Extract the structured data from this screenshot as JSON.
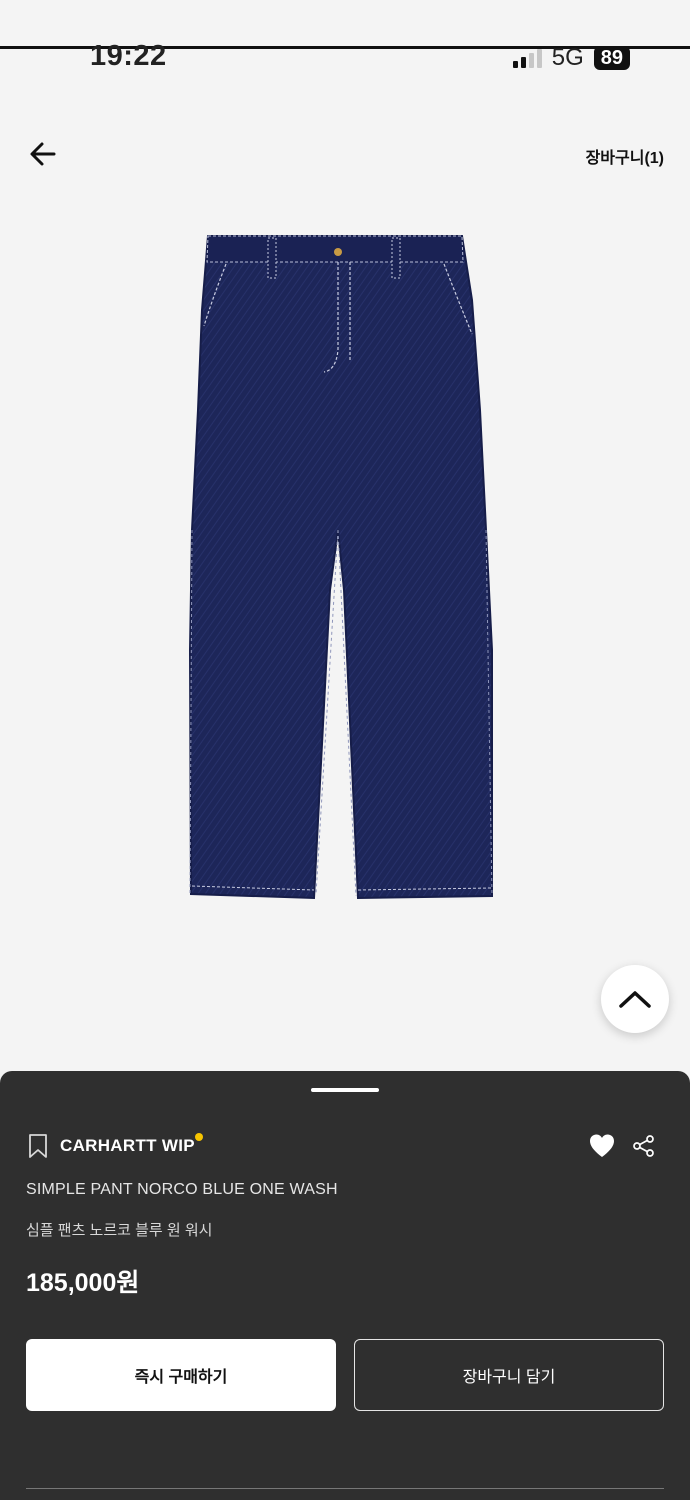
{
  "status_bar": {
    "time": "19:22",
    "network": "5G",
    "battery": "89"
  },
  "header": {
    "back_icon": "arrow-left-icon",
    "cart_label": "장바구니(1)"
  },
  "product": {
    "image_icon": "jeans-image",
    "brand": "CARHARTT WIP",
    "name_en": "SIMPLE PANT NORCO BLUE ONE WASH",
    "name_ko": "심플 팬츠 노르코 블루 원 워시",
    "price": "185,000원"
  },
  "actions": {
    "buy_now_label": "즉시 구매하기",
    "add_to_cart_label": "장바구니 담기"
  },
  "colors": {
    "sheet_bg": "#2f2f2f",
    "brand_dot": "#f6c400",
    "denim": "#1c2557"
  }
}
